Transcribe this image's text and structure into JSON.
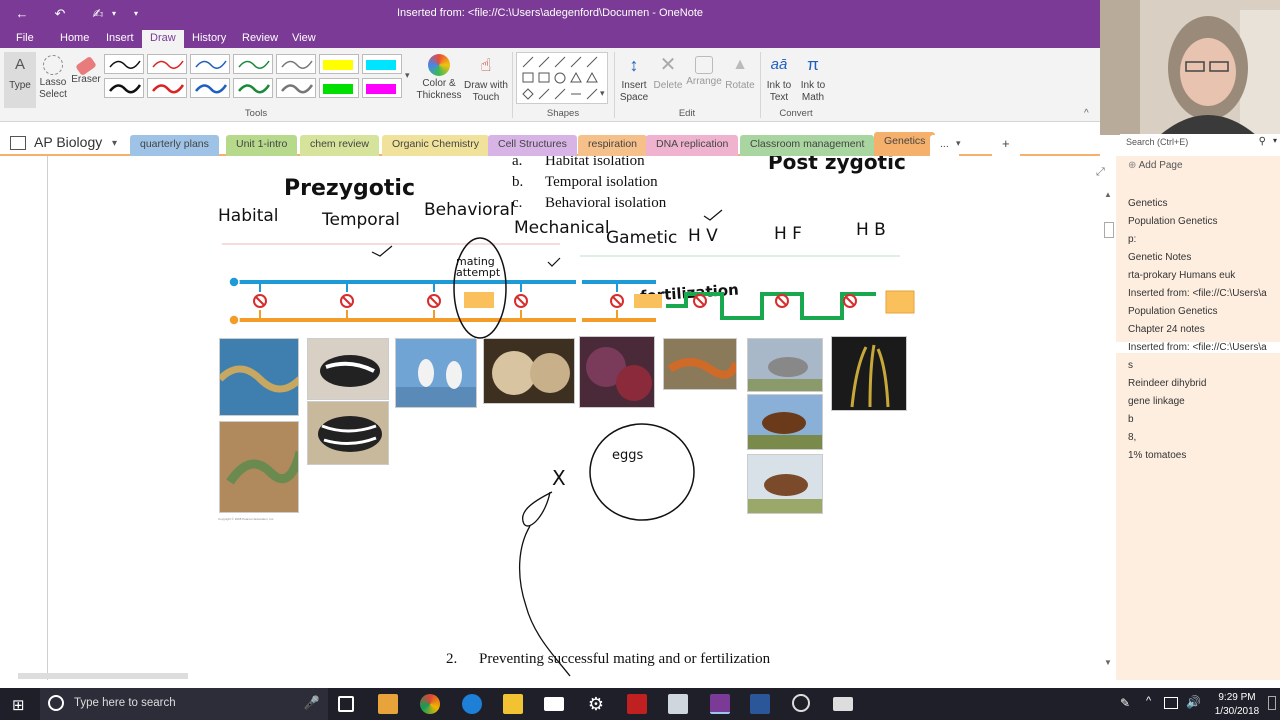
{
  "window": {
    "title": "Inserted from: <file://C:\\Users\\adegenford\\Documen - OneNote"
  },
  "ribbon_tabs": [
    "File",
    "Home",
    "Insert",
    "Draw",
    "History",
    "Review",
    "View"
  ],
  "ribbon": {
    "type_label": "Type",
    "lasso_label": "Lasso\nSelect",
    "lasso_l1": "Lasso",
    "lasso_l2": "Select",
    "eraser_label": "Eraser",
    "color_l1": "Color &",
    "color_l2": "Thickness",
    "drawtouch_l1": "Draw with",
    "drawtouch_l2": "Touch",
    "insert_l1": "Insert",
    "insert_l2": "Space",
    "delete_label": "Delete",
    "arrange_label": "Arrange",
    "rotate_label": "Rotate",
    "inktotext_l1": "Ink to",
    "inktotext_l2": "Text",
    "inktomath_l1": "Ink to",
    "inktomath_l2": "Math",
    "groups": {
      "tools": "Tools",
      "shapes": "Shapes",
      "edit": "Edit",
      "convert": "Convert"
    }
  },
  "search": {
    "placeholder": "Search (Ctrl+E)"
  },
  "notebook": {
    "name": "AP Biology",
    "sections": [
      {
        "label": "quarterly plans",
        "color": "#9fc3e6"
      },
      {
        "label": "Unit 1-intro",
        "color": "#b6d98c"
      },
      {
        "label": "chem review",
        "color": "#d6e39a"
      },
      {
        "label": "Organic Chemistry",
        "color": "#f0e29a"
      },
      {
        "label": "Cell Structures",
        "color": "#d8b4e6"
      },
      {
        "label": "respiration",
        "color": "#f6c08a"
      },
      {
        "label": "DNA replication",
        "color": "#efb3cf"
      },
      {
        "label": "Classroom management",
        "color": "#a9d6a0"
      },
      {
        "label": "Genetics",
        "color": "#f5b06b"
      }
    ],
    "more": "...",
    "add": "+"
  },
  "pages": {
    "add_page": "Add Page",
    "items": [
      "Genetics",
      "Population Genetics",
      "p:",
      "Genetic Notes",
      "rta-prokary Humans euk",
      "Inserted from: <file://C:\\Users\\a",
      "Population Genetics",
      "Chapter 24 notes",
      "Inserted from: <file://C:\\Users\\a",
      "s",
      "Reindeer dihybrid",
      "gene linkage",
      "b",
      "8,",
      "1% tomatoes"
    ],
    "active_index": 8
  },
  "note": {
    "outline": [
      {
        "marker": "a.",
        "text": "Habitat isolation"
      },
      {
        "marker": "b.",
        "text": "Temporal isolation"
      },
      {
        "marker": "c.",
        "text": "Behavioral isolation"
      }
    ],
    "point2_marker": "2.",
    "point2_text": "Preventing successful mating and or fertilization",
    "ink": {
      "prezygotic": "Prezygotic",
      "postzygotic": "Post zygotic",
      "habitat": "Habital",
      "temporal": "Temporal",
      "behavioral": "Behavioral",
      "mechanical": "Mechanical",
      "gametic": "Gametic",
      "hv": "H V",
      "hf": "H F",
      "hb": "H B",
      "mating_attempt": "mating attempt",
      "fertilization": "fertilization",
      "eggs": "eggs",
      "x": "X"
    }
  },
  "taskbar": {
    "search_placeholder": "Type here to search",
    "time": "9:29 PM",
    "date": "1/30/2018"
  },
  "colors": {
    "accent": "#7b3a96",
    "genetics_tab": "#f5b06b",
    "page_pane": "#fdeee0",
    "blue_line": "#1e9ad6",
    "orange_line": "#f39c27",
    "green_line": "#1aa84e",
    "red_sign": "#d92d2d"
  }
}
